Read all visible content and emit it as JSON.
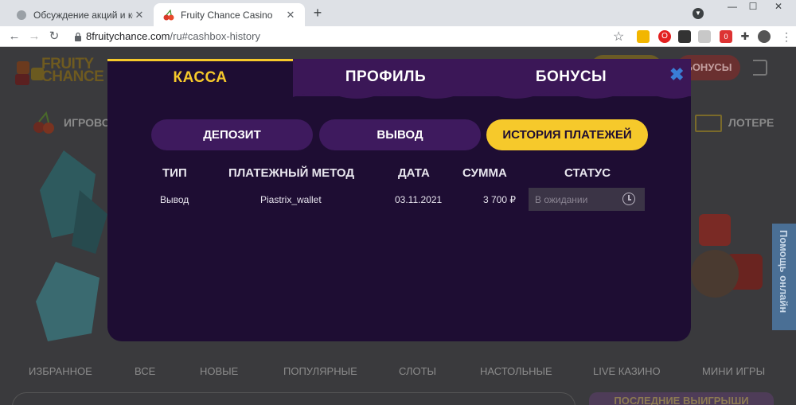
{
  "browser": {
    "tabs": [
      {
        "title": "Обсуждение акций и конкурсов"
      },
      {
        "title": "Fruity Chance Casino"
      }
    ],
    "new_tab": "+",
    "window_controls": {
      "minimize": "—",
      "maximize": "☐",
      "close": "✕"
    },
    "url": {
      "host": "8fruitychance.com",
      "path": "/ru#cashbox-history"
    },
    "extension_badge": "0"
  },
  "site": {
    "logo_text": "FRUITY CHANCE",
    "header_bonus_label": "БОНУСЫ",
    "category_left": "ИГРОВО",
    "category_right": "ЛОТЕРЕ",
    "help_tab": "Помощь онлайн",
    "categories": [
      "ИЗБРАННОЕ",
      "ВСЕ",
      "НОВЫЕ",
      "ПОПУЛЯРНЫЕ",
      "СЛОТЫ",
      "НАСТОЛЬНЫЕ",
      "LIVE КАЗИНО",
      "МИНИ ИГРЫ"
    ],
    "winners_title": "ПОСЛЕДНИЕ ВЫИГРЫШИ"
  },
  "modal": {
    "tabs": [
      {
        "label": "КАССА",
        "active": true
      },
      {
        "label": "ПРОФИЛЬ",
        "active": false
      },
      {
        "label": "БОНУСЫ",
        "active": false
      }
    ],
    "close_label": "✖",
    "subtabs": [
      {
        "label": "ДЕПОЗИТ",
        "active": false
      },
      {
        "label": "ВЫВОД",
        "active": false
      },
      {
        "label": "ИСТОРИЯ ПЛАТЕЖЕЙ",
        "active": true
      }
    ],
    "table": {
      "headers": [
        "ТИП",
        "ПЛАТЕЖНЫЙ МЕТОД",
        "ДАТА",
        "СУММА",
        "СТАТУС"
      ],
      "rows": [
        {
          "type": "Вывод",
          "method": "Piastrix_wallet",
          "date": "03.11.2021",
          "amount": "3 700 ₽",
          "status": "В ожидании"
        }
      ]
    }
  },
  "colors": {
    "accent": "#f6c92b",
    "modal_bg": "#1e0d33",
    "tab_bg": "#3b1757",
    "close": "#3a7ed5"
  }
}
